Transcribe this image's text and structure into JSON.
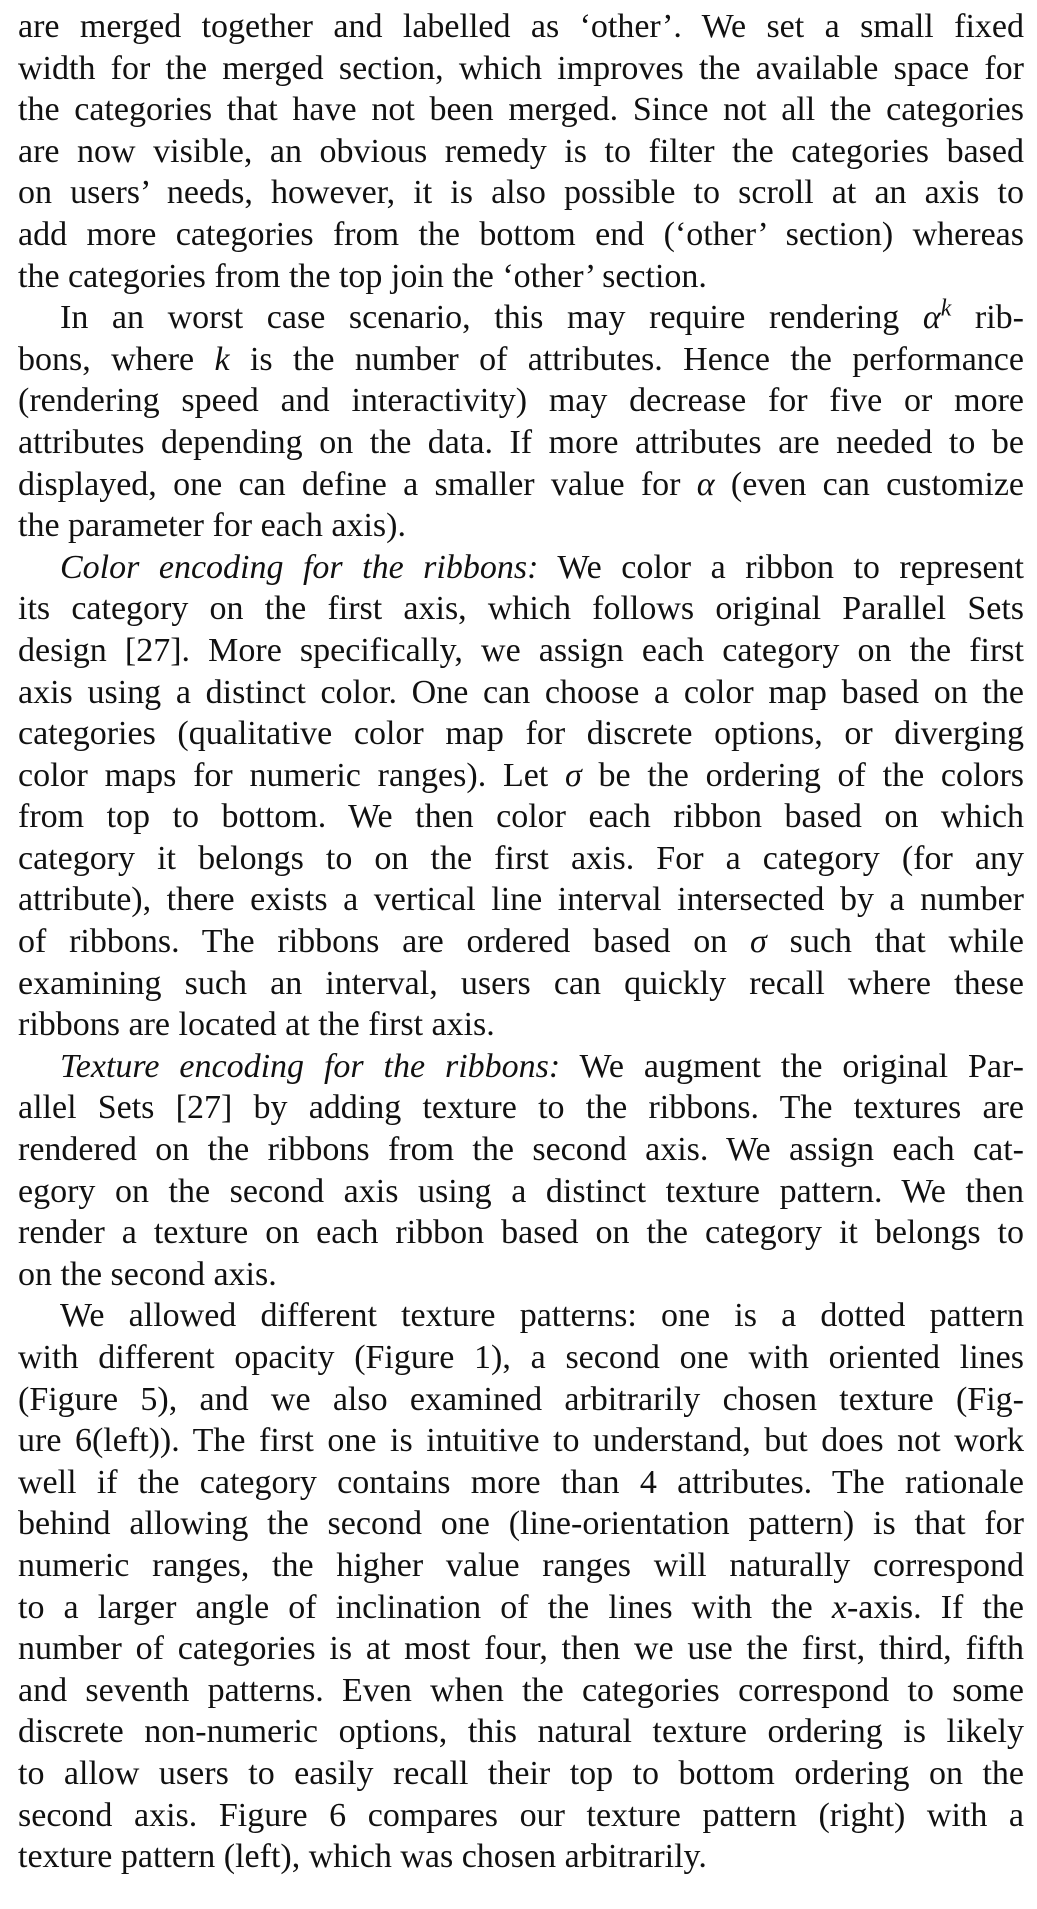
{
  "paragraphs": [
    {
      "lead": "",
      "lines": [
        "are merged together and labelled as ‘other’. We set a small fixed",
        "width for the merged section, which improves the available space for",
        "the categories that have not been merged. Since not all the categories",
        "are now visible, an obvious remedy is to filter the categories based",
        "on users’ needs, however, it is also possible to scroll at an axis to",
        "add more categories from the bottom end (‘other’ section) whereas",
        "the categories from the top join the ‘other’ section."
      ]
    },
    {
      "lead": "",
      "lines": [
        "In an worst case scenario, this may require rendering αᵏ rib-",
        "bons, where k is the number of attributes. Hence the performance",
        "(rendering speed and interactivity) may decrease for five or more",
        "attributes depending on the data. If more attributes are needed to be",
        "displayed, one can define a smaller value for α (even can customize",
        "the parameter for each axis)."
      ]
    },
    {
      "lead": "Color encoding for the ribbons:",
      "lines": [
        "We color a ribbon to represent",
        "its category on the first axis, which follows original Parallel Sets",
        "design [27]. More specifically, we assign each category on the first",
        "axis using a distinct color. One can choose a color map based on the",
        "categories (qualitative color map for discrete options, or diverging",
        "color maps for numeric ranges). Let σ be the ordering of the colors",
        "from top to bottom. We then color each ribbon based on which",
        "category it belongs to on the first axis. For a category (for any",
        "attribute), there exists a vertical line interval intersected by a number",
        "of ribbons. The ribbons are ordered based on σ such that while",
        "examining such an interval, users can quickly recall where these",
        "ribbons are located at the first axis."
      ]
    },
    {
      "lead": "Texture encoding for the ribbons:",
      "lines": [
        "We augment the original Par-",
        "allel Sets [27] by adding texture to the ribbons. The textures are",
        "rendered on the ribbons from the second axis. We assign each cat-",
        "egory on the second axis using a distinct texture pattern. We then",
        "render a texture on each ribbon based on the category it belongs to",
        "on the second axis."
      ]
    },
    {
      "lead": "",
      "lines": [
        "We allowed different texture patterns: one is a dotted pattern",
        "with different opacity (Figure 1), a second one with oriented lines",
        "(Figure 5), and we also examined arbitrarily chosen texture (Fig-",
        "ure 6(left)). The first one is intuitive to understand, but does not work",
        "well if the category contains more than 4 attributes. The rationale",
        "behind allowing the second one (line-orientation pattern) is that for",
        "numeric ranges, the higher value ranges will naturally correspond",
        "to a larger angle of inclination of the lines with the x-axis. If the",
        "number of categories is at most four, then we use the first, third, fifth",
        "and seventh patterns. Even when the categories correspond to some",
        "discrete non-numeric options, this natural texture ordering is likely",
        "to allow users to easily recall their top to bottom ordering on the",
        "second axis. Figure 6 compares our texture pattern (right) with a",
        "texture pattern (left), which was chosen arbitrarily."
      ]
    }
  ]
}
